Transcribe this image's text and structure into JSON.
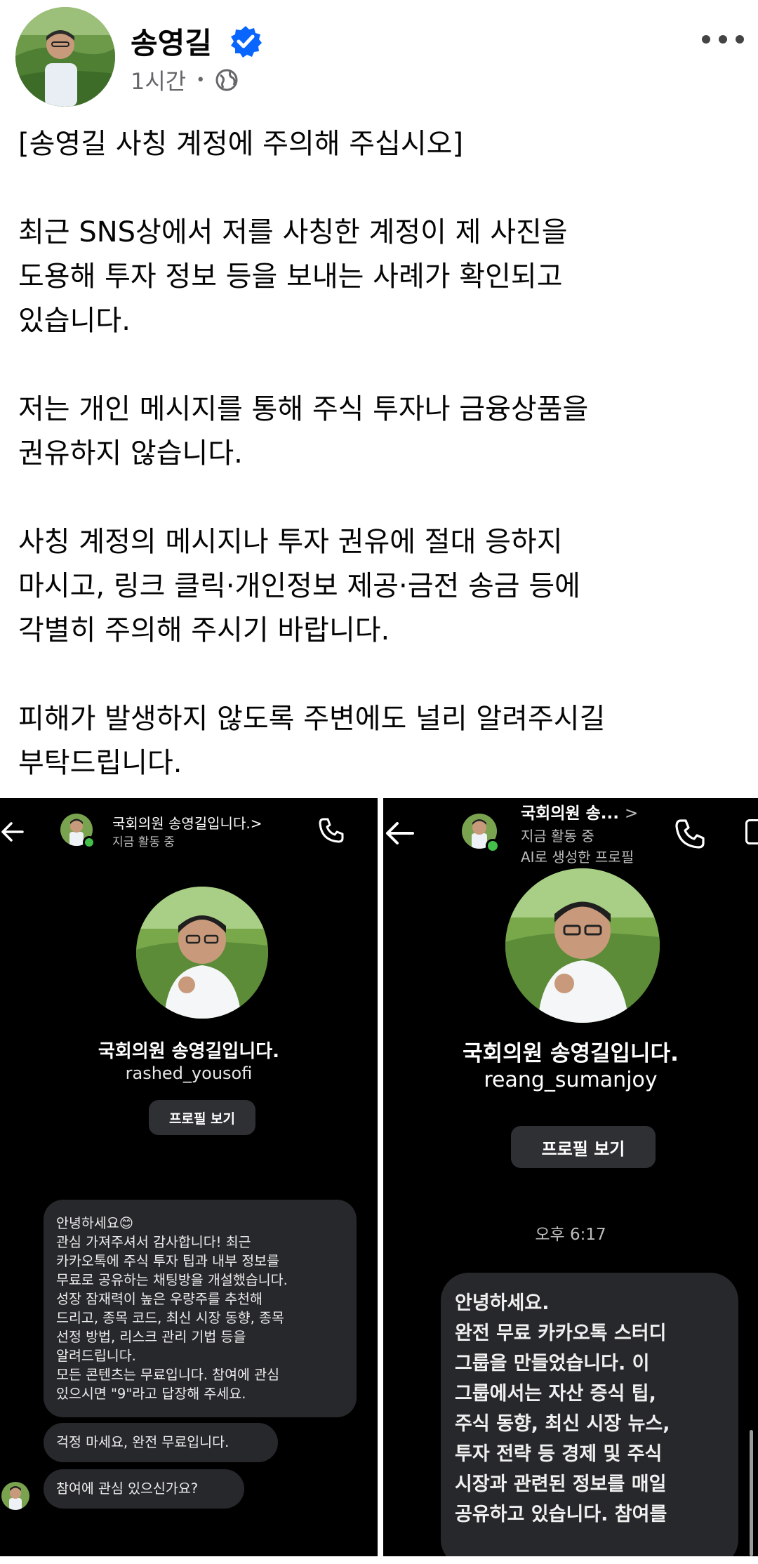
{
  "post": {
    "author": "송영길",
    "time": "1시간",
    "dot": "•",
    "icons": {
      "verified": "verified-badge-icon",
      "audience": "globe-icon",
      "more": "more-options-icon"
    },
    "title": "[송영길 사칭 계정에 주의해 주십시오]",
    "paragraph1": "최근 SNS상에서 저를 사칭한 계정이 제 사진을\n도용해 투자 정보 등을 보내는 사례가 확인되고\n있습니다.",
    "paragraph2": "저는 개인 메시지를 통해 주식 투자나 금융상품을\n권유하지 않습니다.",
    "paragraph3": "사칭 계정의 메시지나 투자 권유에 절대 응하지\n마시고, 링크 클릭·개인정보 제공·금전 송금 등에\n각별히 주의해 주시기 바랍니다.",
    "paragraph4": "피해가 발생하지 않도록 주변에도 널리 알려주시길\n부탁드립니다."
  },
  "screenshot_left": {
    "header_name": "국회의원 송영길입니다.",
    "header_chevron": ">",
    "header_status": "지금 활동 중",
    "profile_name": "국회의원 송영길입니다.",
    "profile_handle": "rashed_yousofi",
    "profile_button": "프로필 보기",
    "message1": "안녕하세요😊\n관심 가져주셔서 감사합니다! 최근\n카카오톡에 주식 투자 팁과 내부 정보를\n무료로 공유하는 채팅방을 개설했습니다.\n성장 잠재력이 높은 우량주를 추천해\n드리고, 종목 코드, 최신 시장 동향, 종목\n선정 방법, 리스크 관리 기법 등을\n알려드립니다.\n모든 콘텐츠는 무료입니다. 참여에 관심\n있으시면 \"9\"라고 답장해 주세요.",
    "message2": "걱정 마세요, 완전 무료입니다.",
    "message3": "참여에 관심 있으신가요?"
  },
  "screenshot_right": {
    "header_name": "국회의원 송...",
    "header_chevron": ">",
    "header_status": "지금 활동 중",
    "header_ai_label": "AI로 생성한 프로필",
    "profile_name": "국회의원 송영길입니다.",
    "profile_handle": "reang_sumanjoy",
    "profile_button": "프로필 보기",
    "timestamp": "오후 6:17",
    "message1": "안녕하세요.\n완전 무료 카카오톡 스터디\n그룹을 만들었습니다. 이\n그룹에서는 자산 증식 팁,\n주식 동향, 최신 시장 뉴스,\n투자 전략 등 경제 및 주식\n시장과 관련된 정보를 매일\n공유하고 있습니다. 참여를"
  },
  "colors": {
    "verified_blue": "#0866ff",
    "meta_gray": "#65676b",
    "bubble_dark": "#27282b",
    "online_green": "#44c04a"
  }
}
